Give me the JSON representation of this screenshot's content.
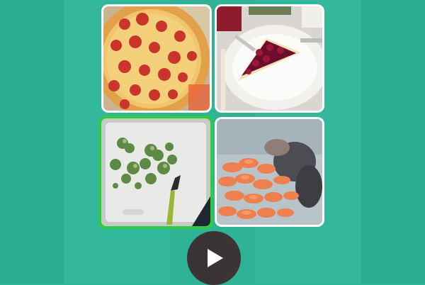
{
  "game": {
    "tiles": [
      {
        "name": "pizza",
        "selected": false
      },
      {
        "name": "berry-pie",
        "selected": false
      },
      {
        "name": "broccoli",
        "selected": true
      },
      {
        "name": "shrimp",
        "selected": false
      }
    ],
    "play_button": {
      "icon": "play-icon"
    },
    "colors": {
      "background": "#2fb59a",
      "selected_border": "#2ecc40",
      "play_button": "#3a3434"
    }
  }
}
